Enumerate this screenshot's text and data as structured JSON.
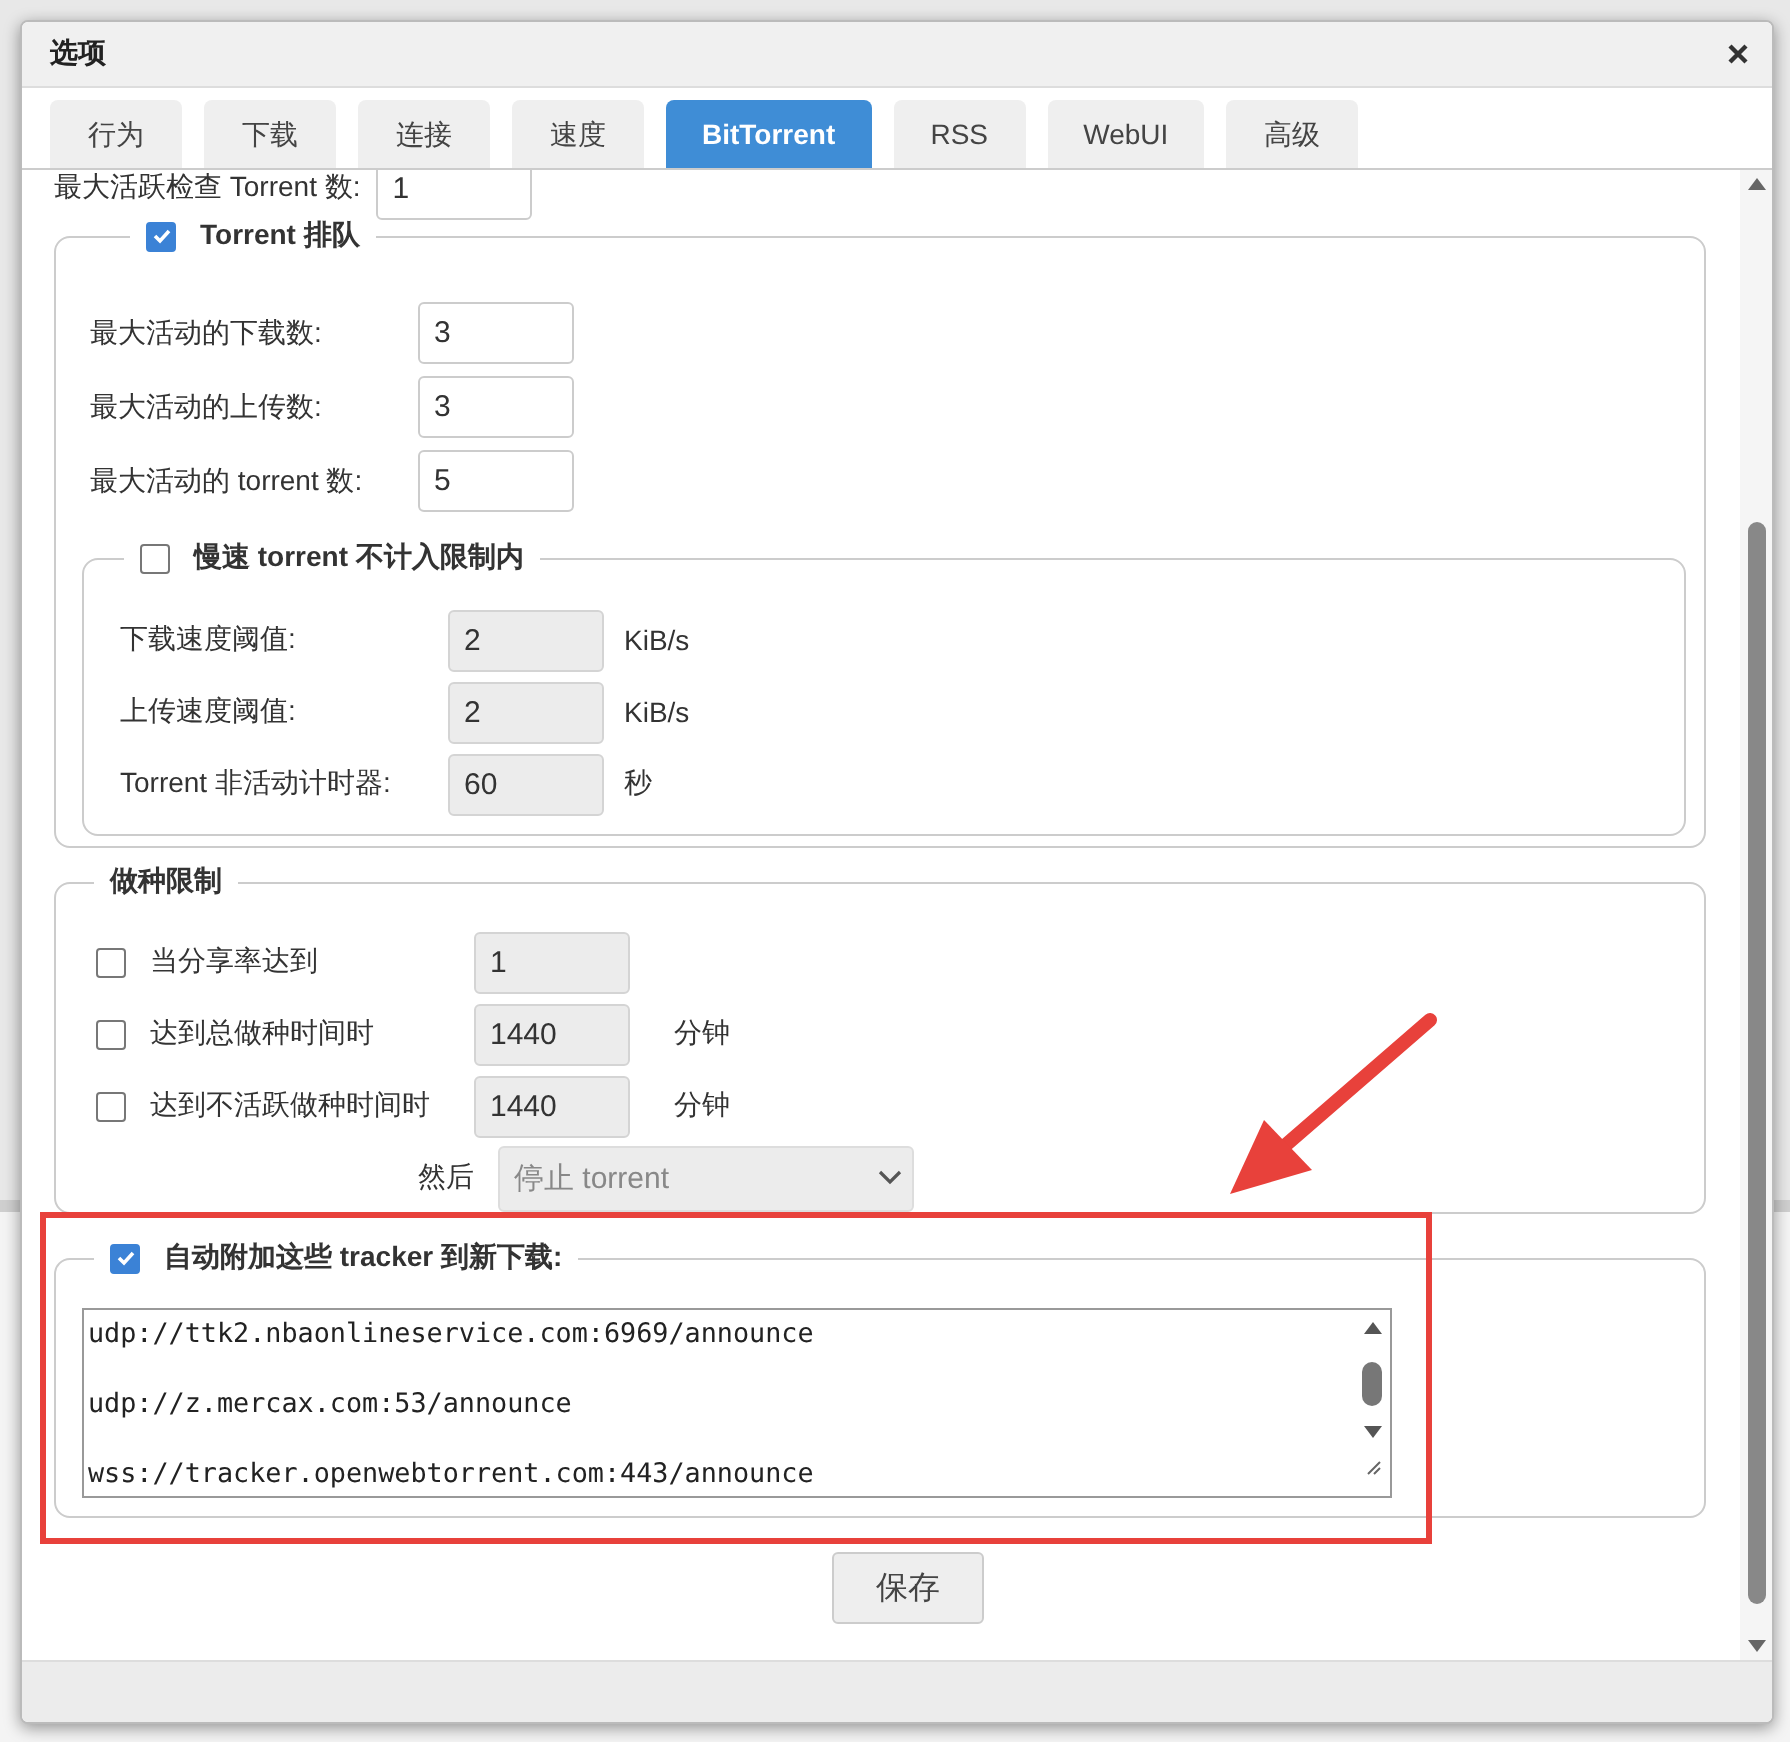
{
  "window": {
    "title": "选项"
  },
  "tabs": [
    {
      "label": "行为",
      "selected": false
    },
    {
      "label": "下载",
      "selected": false
    },
    {
      "label": "连接",
      "selected": false
    },
    {
      "label": "速度",
      "selected": false
    },
    {
      "label": "BitTorrent",
      "selected": true
    },
    {
      "label": "RSS",
      "selected": false
    },
    {
      "label": "WebUI",
      "selected": false
    },
    {
      "label": "高级",
      "selected": false
    }
  ],
  "max_checking": {
    "label": "最大活跃检查 Torrent 数:",
    "value": "1",
    "disabled": false
  },
  "queue": {
    "label": "Torrent 排队",
    "checked": true,
    "fields": [
      {
        "label": "最大活动的下载数:",
        "value": "3",
        "disabled": false
      },
      {
        "label": "最大活动的上传数:",
        "value": "3",
        "disabled": false
      },
      {
        "label": "最大活动的 torrent 数:",
        "value": "5",
        "disabled": false
      }
    ],
    "slow": {
      "label": "慢速 torrent 不计入限制内",
      "checked": false,
      "fields": [
        {
          "label": "下载速度阈值:",
          "value": "2",
          "unit": "KiB/s",
          "disabled": true
        },
        {
          "label": "上传速度阈值:",
          "value": "2",
          "unit": "KiB/s",
          "disabled": true
        },
        {
          "label": "Torrent 非活动计时器:",
          "value": "60",
          "unit": "秒",
          "disabled": true
        }
      ]
    }
  },
  "seeding": {
    "legend": "做种限制",
    "rows": [
      {
        "kind": "check",
        "label": "当分享率达到",
        "checked": false,
        "value": "1",
        "disabled": true
      },
      {
        "kind": "check",
        "label": "达到总做种时间时",
        "checked": false,
        "value": "1440",
        "unit": "分钟",
        "disabled": true
      },
      {
        "kind": "check",
        "label": "达到不活跃做种时间时",
        "checked": false,
        "value": "1440",
        "unit": "分钟",
        "disabled": true
      },
      {
        "kind": "select",
        "label": "然后",
        "value": "停止 torrent",
        "disabled": true
      }
    ]
  },
  "trackers": {
    "label": "自动附加这些 tracker 到新下载:",
    "checked": true,
    "lines": [
      "udp://ttk2.nbaonlineservice.com:6969/announce",
      "udp://z.mercax.com:53/announce",
      "wss://tracker.openwebtorrent.com:443/announce"
    ]
  },
  "save_button": "保存"
}
